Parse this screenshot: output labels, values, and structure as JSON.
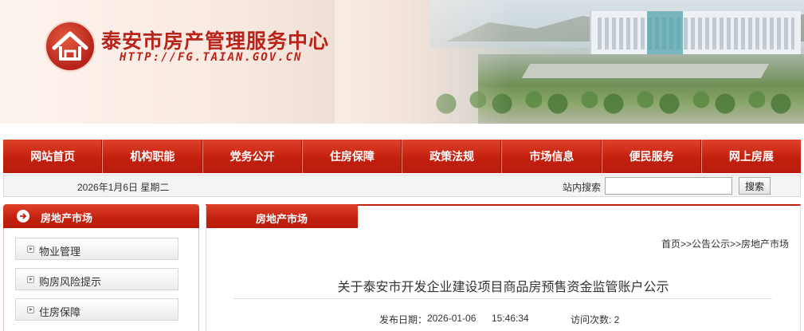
{
  "header": {
    "site_title": "泰安市房产管理服务中心",
    "site_url": "HTTP://FG.TAIAN.GOV.CN",
    "logo_icon": "house-in-circle-icon"
  },
  "nav": {
    "items": [
      {
        "label": "网站首页"
      },
      {
        "label": "机构职能"
      },
      {
        "label": "党务公开"
      },
      {
        "label": "住房保障"
      },
      {
        "label": "政策法规"
      },
      {
        "label": "市场信息"
      },
      {
        "label": "便民服务"
      },
      {
        "label": "网上房展"
      }
    ]
  },
  "datebar": {
    "date": "2026年1月6日 星期二",
    "search_label": "站内搜索",
    "search_value": "",
    "search_button": "搜索"
  },
  "sidebar": {
    "title": "房地产市场",
    "title_icon": "arrow-right-circle-icon",
    "items": [
      {
        "label": "物业管理"
      },
      {
        "label": "购房风险提示"
      },
      {
        "label": "住房保障"
      }
    ]
  },
  "main": {
    "tab_title": "房地产市场",
    "breadcrumb": "首页>>公告公示>>房地产市场",
    "article_title": "关于泰安市开发企业建设项目商品房预售资金监管账户公示",
    "published_label": "发布日期：",
    "published_date": "2026-01-06",
    "published_time": "15:46:34",
    "visits": "访问次数: 2"
  },
  "colors": {
    "brand_red": "#c3200f",
    "title_red": "#b8231a"
  }
}
